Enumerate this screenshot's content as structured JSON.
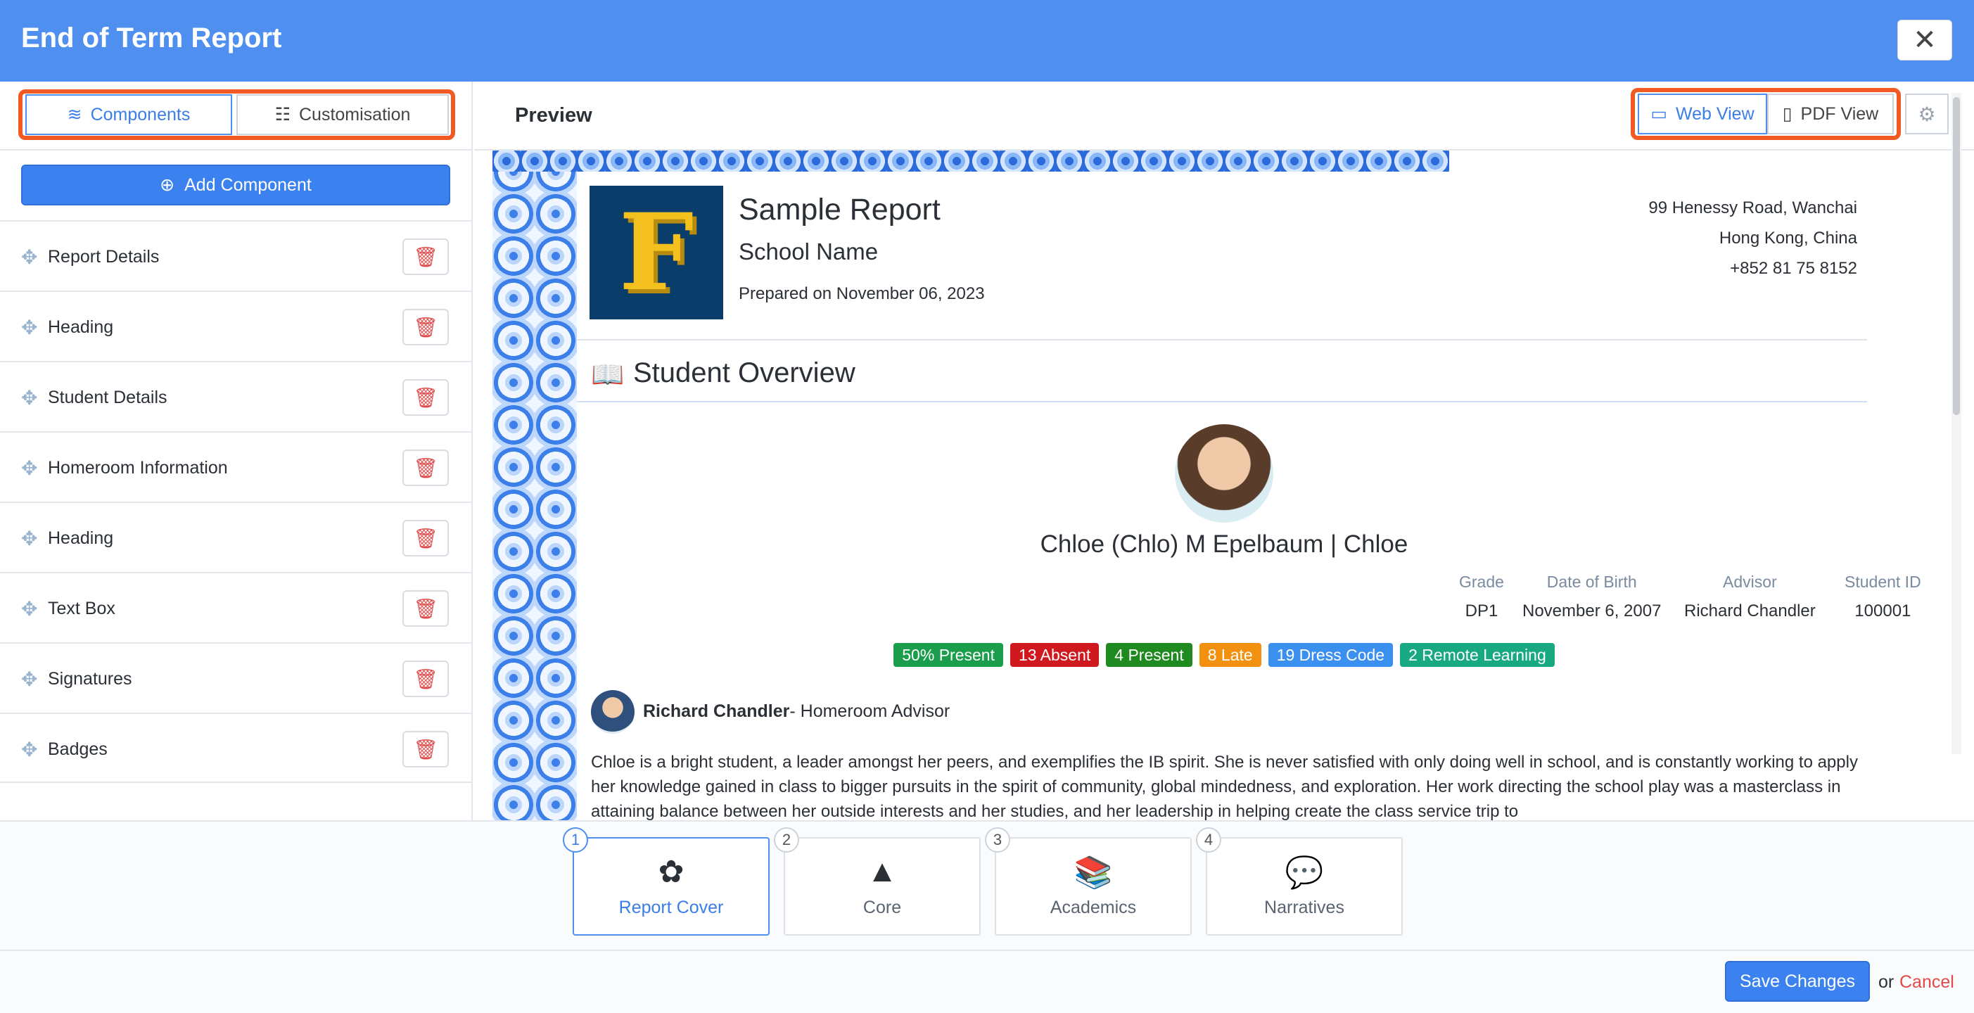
{
  "app": {
    "title": "End of Term Report",
    "close_icon": "close-icon"
  },
  "left": {
    "tabs": [
      {
        "label": "Components",
        "icon": "layers-icon"
      },
      {
        "label": "Customisation",
        "icon": "sliders-icon"
      }
    ],
    "add_button": "Add Component",
    "components": [
      {
        "label": "Report Details"
      },
      {
        "label": "Heading"
      },
      {
        "label": "Student Details"
      },
      {
        "label": "Homeroom Information"
      },
      {
        "label": "Heading"
      },
      {
        "label": "Text Box"
      },
      {
        "label": "Signatures"
      },
      {
        "label": "Badges"
      }
    ]
  },
  "preview": {
    "label": "Preview",
    "web_view": "Web View",
    "pdf_view": "PDF View"
  },
  "report": {
    "title": "Sample Report",
    "school": "School Name",
    "prepared": "Prepared on November 06, 2023",
    "address": [
      "99 Henessy Road, Wanchai",
      "Hong Kong, China",
      "+852 81 75 8152"
    ],
    "overview_title": "Student Overview",
    "student_name": "Chloe (Chlo) M Epelbaum | Chloe",
    "info": [
      {
        "label": "Grade",
        "value": "DP1"
      },
      {
        "label": "Date of Birth",
        "value": "November 6, 2007"
      },
      {
        "label": "Advisor",
        "value": "Richard Chandler"
      },
      {
        "label": "Student ID",
        "value": "100001"
      }
    ],
    "badges": [
      {
        "text": "50% Present",
        "color": "#1a9e4b"
      },
      {
        "text": "13 Absent",
        "color": "#d0191e"
      },
      {
        "text": "4 Present",
        "color": "#1f8a1f"
      },
      {
        "text": "8 Late",
        "color": "#f2900f"
      },
      {
        "text": "19 Dress Code",
        "color": "#3b8fef"
      },
      {
        "text": "2 Remote Learning",
        "color": "#18a882"
      }
    ],
    "advisor_name": "Richard Chandler",
    "advisor_role": "- Homeroom Advisor",
    "narrative": "Chloe is a bright student, a leader amongst her peers, and exemplifies the IB spirit. She is never satisfied with only doing well in school, and is constantly working to apply her knowledge gained in class to bigger pursuits in the spirit of community, global mindedness, and exploration. Her work directing the school play was a masterclass in attaining balance between her outside interests and her studies, and her leadership in helping create the class service trip to"
  },
  "steps": [
    {
      "num": "1",
      "label": "Report Cover",
      "icon": "report-cover-icon"
    },
    {
      "num": "2",
      "label": "Core",
      "icon": "core-icon"
    },
    {
      "num": "3",
      "label": "Academics",
      "icon": "academics-icon"
    },
    {
      "num": "4",
      "label": "Narratives",
      "icon": "narratives-icon"
    }
  ],
  "footer": {
    "save": "Save Changes",
    "or": "or",
    "cancel": "Cancel"
  }
}
